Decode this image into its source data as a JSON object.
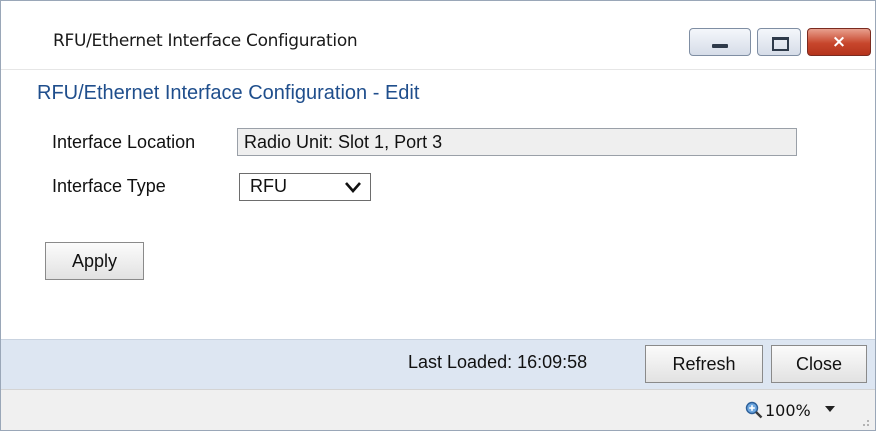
{
  "window": {
    "title": "RFU/Ethernet Interface Configuration",
    "controls": {
      "minimize": "minimize-icon",
      "maximize": "maximize-icon",
      "close": "close-icon"
    },
    "close_glyph": "×",
    "close_color": "#c7462c"
  },
  "form": {
    "section_title": "RFU/Ethernet Interface Configuration - Edit",
    "location_label": "Interface Location",
    "location_value": "Radio Unit: Slot 1, Port 3",
    "type_label": "Interface Type",
    "type_value": "RFU",
    "apply_label": "Apply"
  },
  "footer": {
    "last_loaded": "Last Loaded: 16:09:58",
    "refresh_label": "Refresh",
    "close_label": "Close"
  },
  "statusbar": {
    "zoom": "100%",
    "zoom_icon": "zoom-in-icon"
  },
  "colors": {
    "section_title": "#1f4e8c",
    "footer_bg": "#dde6f2"
  }
}
